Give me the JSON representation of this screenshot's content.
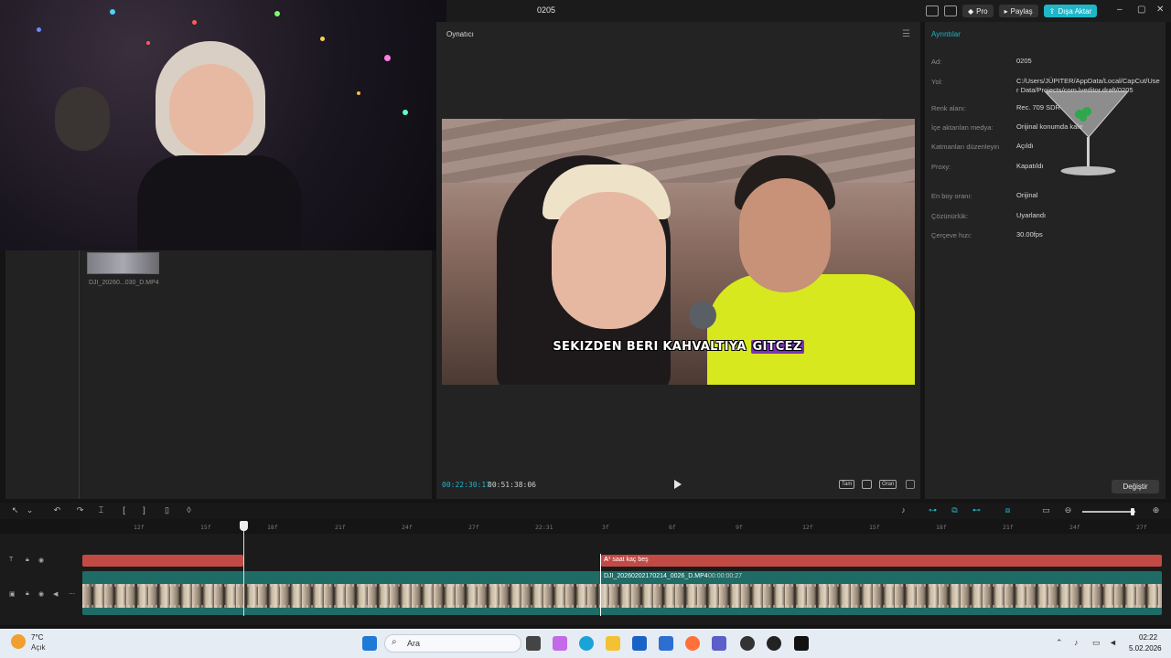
{
  "titlebar": {
    "project_name": "0205",
    "pro_label": "Pro",
    "share_label": "Paylaş",
    "export_label": "Dışa Aktar",
    "accent": "#1fb6c8"
  },
  "media": {
    "clip_label": "DJI_20260...030_D.MP4"
  },
  "player": {
    "title": "Oynatıcı",
    "subtitle_text": "SEKIZDEN BERI KAHVALTIYA",
    "subtitle_highlight": "GITCEZ",
    "current_time": "00:22:30:17",
    "duration": "00:51:38:06",
    "fit_label": "Tam",
    "ratio_label": "Oran"
  },
  "details": {
    "title": "Ayrıntılar",
    "fields": [
      {
        "label": "Ad:",
        "value": "0205"
      },
      {
        "label": "Yol:",
        "value": "C:/Users/JÜPITER/AppData/Local/CapCut/User Data/Projects/com.lveditor.draft/0205"
      },
      {
        "label": "Renk alanı:",
        "value": "Rec. 709 SDR"
      },
      {
        "label": "İçe aktarılan medya:",
        "value": "Orijinal konumda kalır"
      },
      {
        "label": "Katmanları düzenleyin",
        "value": "Açıldı"
      },
      {
        "label": "Proxy:",
        "value": "Kapatıldı"
      },
      {
        "label": "En boy oranı:",
        "value": "Orijinal"
      },
      {
        "label": "Çözünürlük:",
        "value": "Uyarlandı"
      },
      {
        "label": "Çerçeve hızı:",
        "value": "30.00fps"
      }
    ],
    "change_button": "Değiştir"
  },
  "timeline": {
    "ticks": [
      "12f",
      "15f",
      "18f",
      "21f",
      "24f",
      "27f",
      "22:31",
      "3f",
      "6f",
      "9f",
      "12f",
      "15f",
      "18f",
      "21f",
      "24f",
      "27f"
    ],
    "text_clip_label": "saat kaç beş",
    "video_clip_name": "DJI_20260202170214_0026_D.MP4",
    "video_clip_duration": "00:00:00:27"
  },
  "taskbar": {
    "temperature": "7°C",
    "weather": "Açık",
    "search_label": "Ara",
    "time": "02:22",
    "date": "5.02.2026"
  }
}
